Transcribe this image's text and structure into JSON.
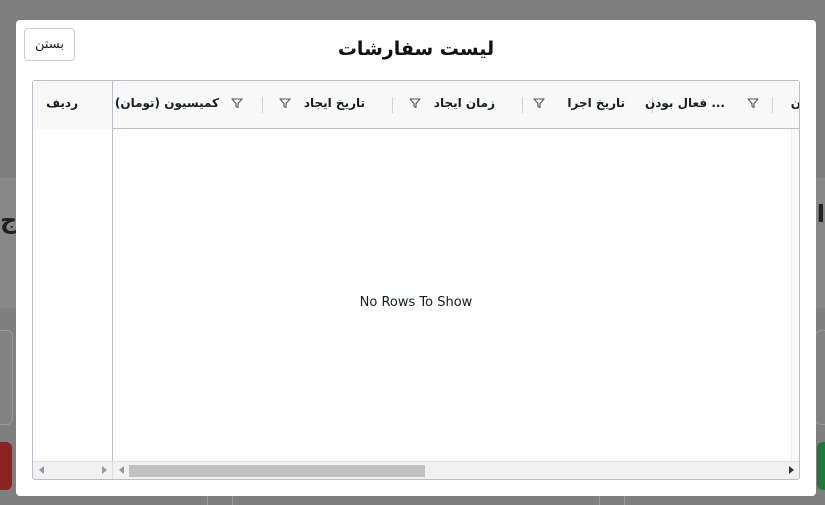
{
  "background": {
    "left_glyph": "ج",
    "right_glyph": "اد"
  },
  "modal": {
    "title": "لیست سفارشات",
    "close_label": "بستن"
  },
  "grid": {
    "pinned_header": "ردیف",
    "columns": [
      {
        "key": "commission",
        "label": "کمیسیون (تومان)"
      },
      {
        "key": "created_date",
        "label": "تاریخ ایجاد"
      },
      {
        "key": "created_time",
        "label": "زمان ایجاد"
      },
      {
        "key": "exec_date",
        "label": "تاریخ اجرا"
      },
      {
        "key": "active",
        "label": "... فعال بودن"
      },
      {
        "key": "partial",
        "label": "ن"
      }
    ],
    "empty_message": "No Rows To Show"
  },
  "icons": {
    "filter": "filter-icon",
    "scroll_left": "arrow-left-icon",
    "scroll_right": "arrow-right-icon"
  },
  "colors": {
    "overlay": "#7f7f7f",
    "grid_border": "#babfc7",
    "header_bg": "#f8f8f8",
    "danger": "#8a2323",
    "success": "#1f7a3a"
  }
}
